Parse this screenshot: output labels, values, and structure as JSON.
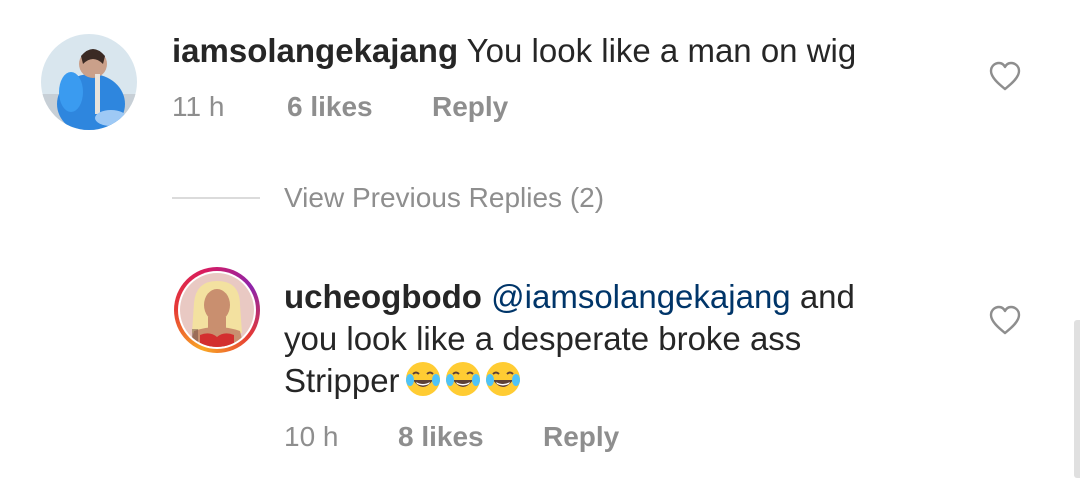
{
  "comments": [
    {
      "username": "iamsolangekajang",
      "text": " You look like a man on wig",
      "time": "11 h",
      "likes": "6 likes",
      "reply_label": "Reply"
    },
    {
      "username": "ucheogbodo",
      "mention": "@iamsolangekajang",
      "text_line1": " and",
      "text_line2": "you look like a desperate  broke ass",
      "text_line3": "Stripper",
      "emoji_count": 3,
      "time": "10 h",
      "likes": "8 likes",
      "reply_label": "Reply"
    }
  ],
  "view_previous_replies": "View Previous Replies (2)",
  "colors": {
    "text": "#262626",
    "meta": "#8e8e8e",
    "mention": "#003569",
    "divider": "#dbdbdb"
  },
  "icons": {
    "like": "heart-outline-icon",
    "emoji": "face-with-tears-of-joy"
  }
}
